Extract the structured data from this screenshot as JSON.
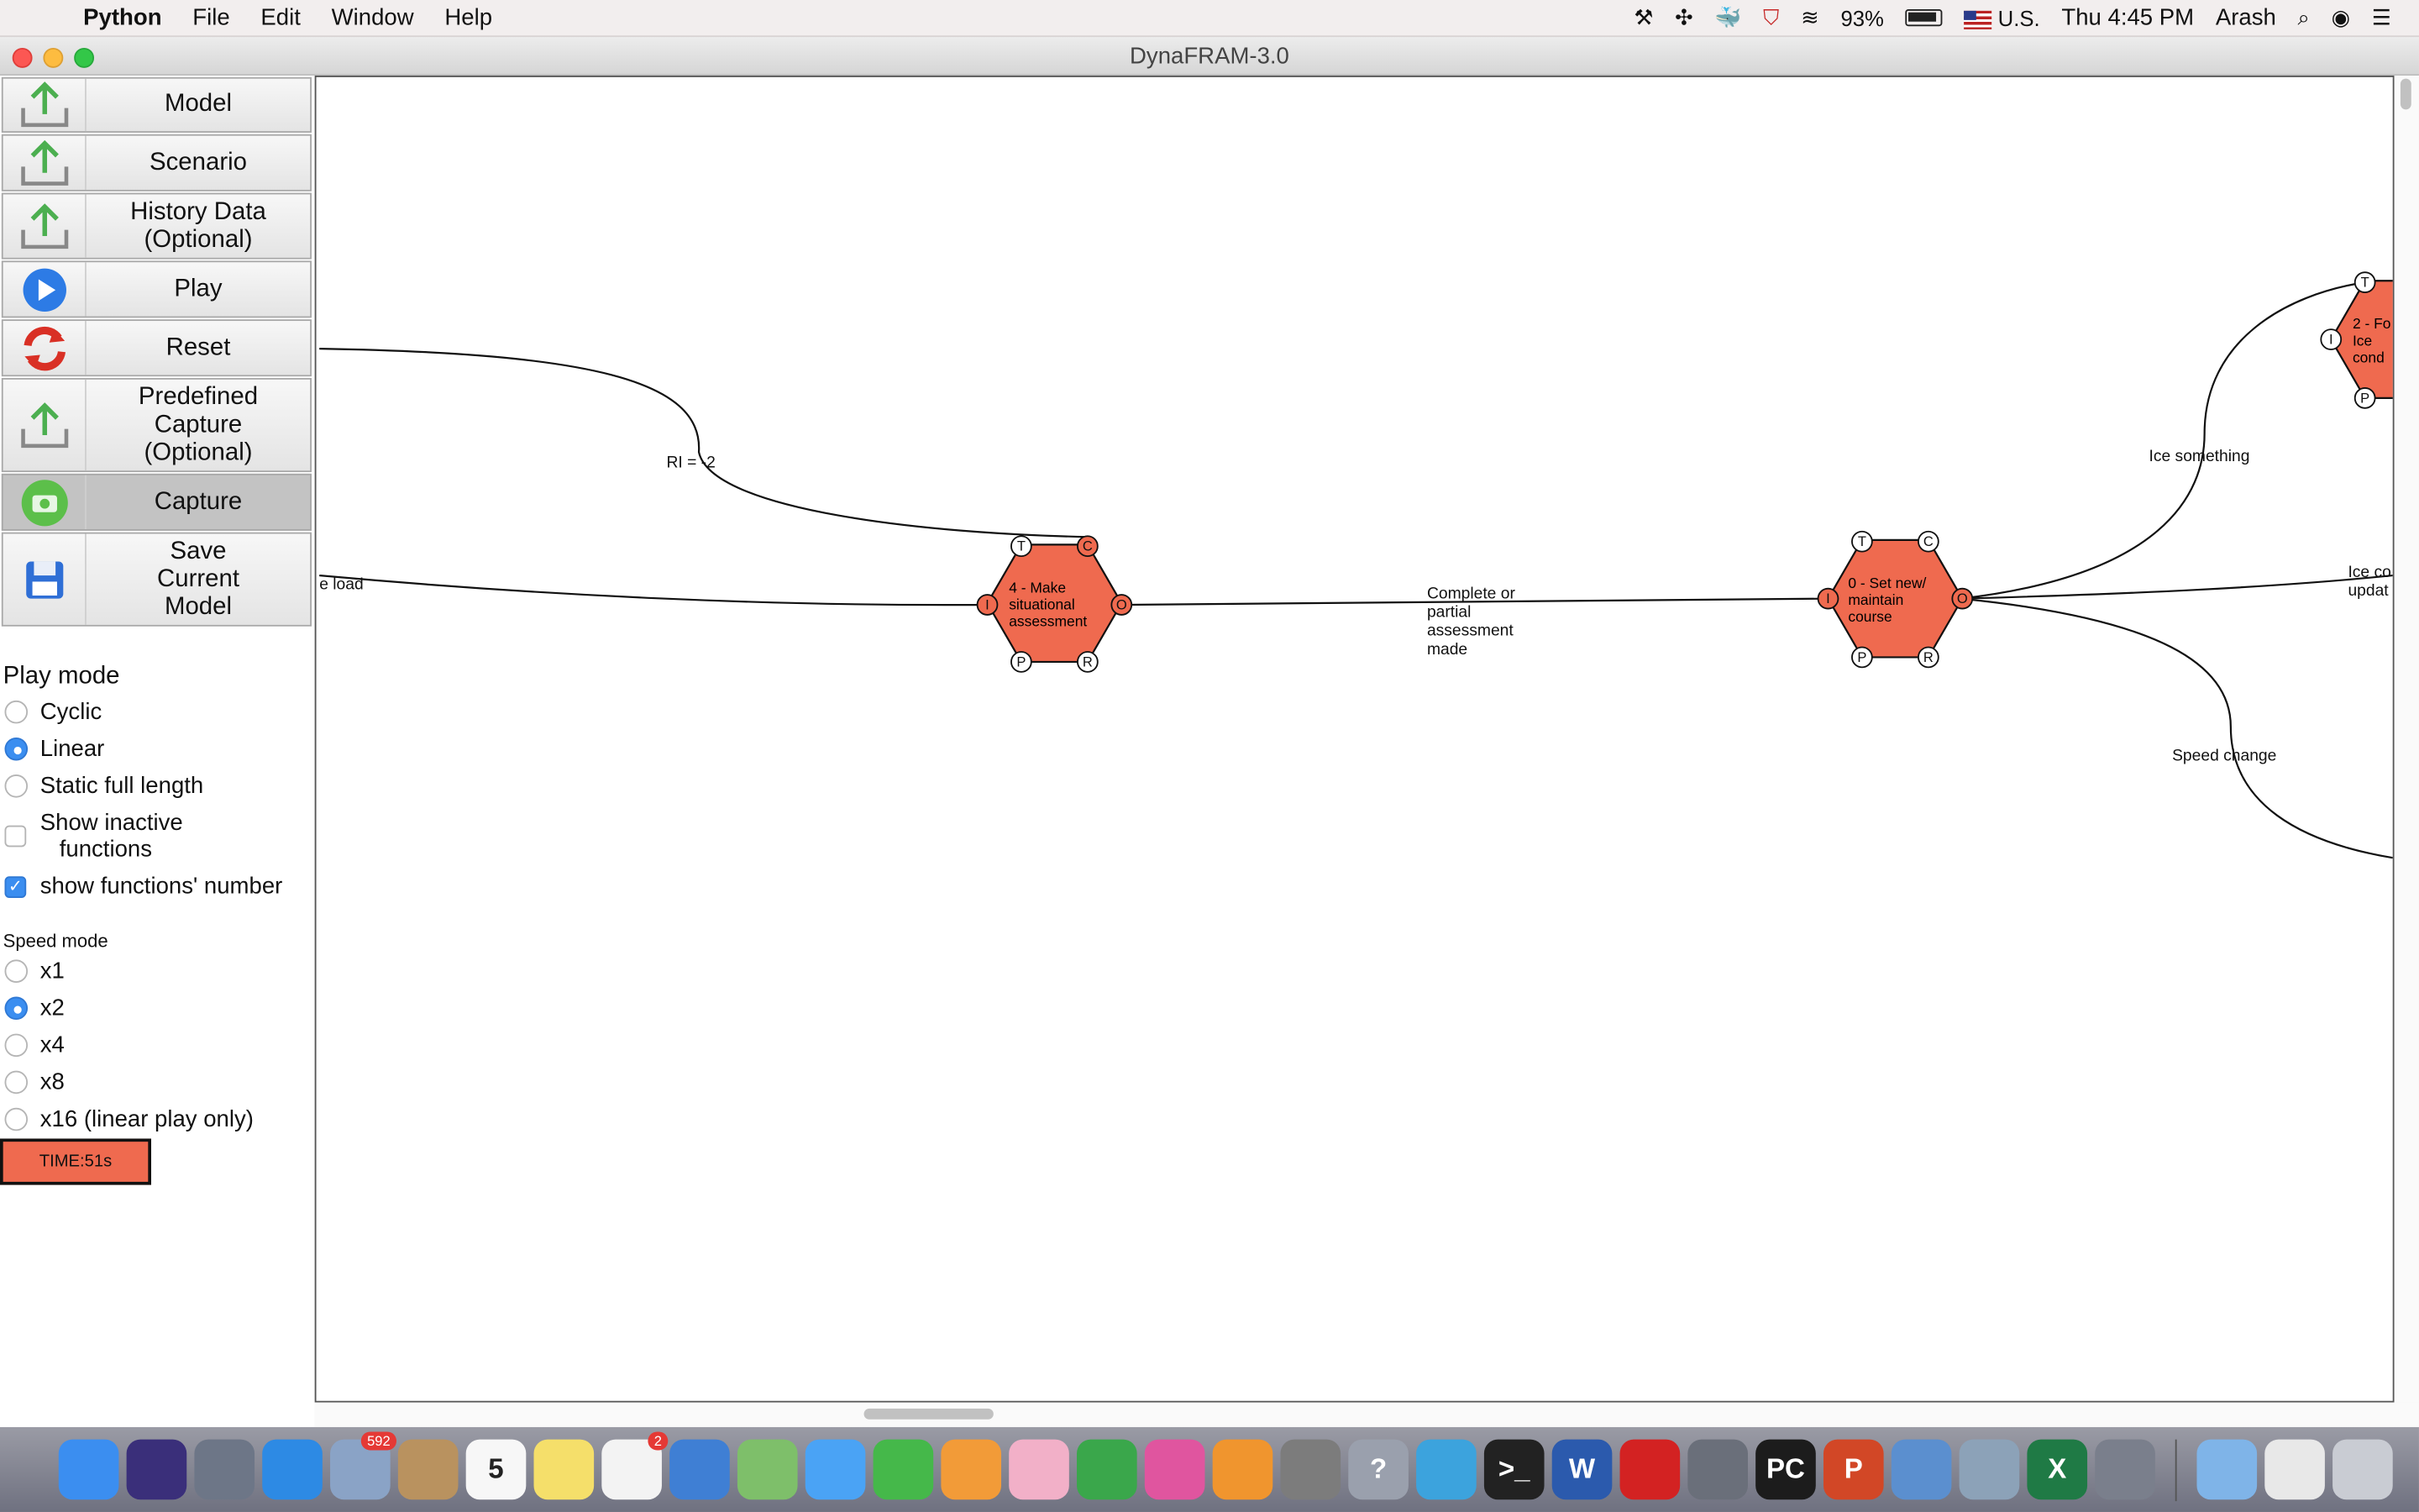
{
  "menubar": {
    "app_name": "Python",
    "menus": [
      "File",
      "Edit",
      "Window",
      "Help"
    ],
    "battery": "93%",
    "input_source": "U.S.",
    "clock": "Thu 4:45 PM",
    "user": "Arash"
  },
  "window": {
    "title": "DynaFRAM-3.0"
  },
  "sidebar": {
    "buttons": [
      {
        "label": "Model",
        "icon": "upload-icon"
      },
      {
        "label": "Scenario",
        "icon": "upload-icon"
      },
      {
        "label": "History Data\n(Optional)",
        "icon": "upload-icon"
      },
      {
        "label": "Play",
        "icon": "play-icon"
      },
      {
        "label": "Reset",
        "icon": "reset-icon"
      },
      {
        "label": "Predefined\nCapture\n(Optional)",
        "icon": "upload-icon"
      },
      {
        "label": "Capture",
        "icon": "camera-icon"
      },
      {
        "label": "Save\nCurrent\nModel",
        "icon": "floppy-disk-icon"
      }
    ],
    "play_mode": {
      "title": "Play mode",
      "options": [
        "Cyclic",
        "Linear",
        "Static full length"
      ],
      "selected": "Linear"
    },
    "show_inactive": {
      "label": "Show inactive\n   functions",
      "checked": false
    },
    "show_numbers": {
      "label": "show functions' number",
      "checked": true
    },
    "speed_mode": {
      "title": "Speed mode",
      "options": [
        "x1",
        "x2",
        "x4",
        "x8",
        "x16 (linear play only)"
      ],
      "selected": "x2"
    },
    "time": "TIME:51s"
  },
  "diagram": {
    "functions": [
      {
        "label": [
          "4 - Make",
          "situational",
          "assessment"
        ]
      },
      {
        "label": [
          "0 - Set new/",
          "maintain",
          "course"
        ]
      },
      {
        "label": [
          "2 - Fo",
          "Ice",
          "cond"
        ]
      }
    ],
    "aspects": {
      "T": "T",
      "C": "C",
      "I": "I",
      "O": "O",
      "P": "P",
      "R": "R"
    },
    "links": [
      {
        "label": "RI = -2"
      },
      {
        "label": "e load"
      },
      {
        "label": "Complete or\npartial\nassessment\nmade"
      },
      {
        "label": "Ice something"
      },
      {
        "label": "Ice co\nupdat"
      },
      {
        "label": "Speed change"
      }
    ],
    "colors": {
      "function_fill": "#ef6a4f",
      "stroke": "#111111"
    }
  },
  "dock": {
    "apps": [
      {
        "name": "finder-icon",
        "color": "#3b8ef0"
      },
      {
        "name": "siri-icon",
        "color": "#3a2f7a"
      },
      {
        "name": "launchpad-icon",
        "color": "#6d7687"
      },
      {
        "name": "safari-icon",
        "color": "#2d8ae4"
      },
      {
        "name": "mail-icon",
        "color": "#8aa3c6",
        "badge": "592"
      },
      {
        "name": "contacts-icon",
        "color": "#b9925f"
      },
      {
        "name": "calendar-icon",
        "color": "#f7f7f7",
        "text": "5"
      },
      {
        "name": "notes-icon",
        "color": "#f5df6a"
      },
      {
        "name": "reminders-icon",
        "color": "#f3f3f3",
        "badge": "2"
      },
      {
        "name": "keynote-icon",
        "color": "#3f7fd4"
      },
      {
        "name": "maps-icon",
        "color": "#7ebf6a"
      },
      {
        "name": "messages-icon",
        "color": "#4aa3f5"
      },
      {
        "name": "facetime-icon",
        "color": "#45b84a"
      },
      {
        "name": "pages-icon",
        "color": "#f29b38"
      },
      {
        "name": "photos-icon",
        "color": "#f2b0c8"
      },
      {
        "name": "numbers-icon",
        "color": "#3aa74b"
      },
      {
        "name": "itunes-icon",
        "color": "#e0559f"
      },
      {
        "name": "books-icon",
        "color": "#f0952e"
      },
      {
        "name": "system-preferences-icon",
        "color": "#7c7c7c"
      },
      {
        "name": "help-icon",
        "color": "#9aa0ad",
        "text": "?"
      },
      {
        "name": "telegram-icon",
        "color": "#3ca3dd"
      },
      {
        "name": "terminal-icon",
        "color": "#222222",
        "text": ">_"
      },
      {
        "name": "word-icon",
        "color": "#2b5aad",
        "text": "W"
      },
      {
        "name": "acrobat-icon",
        "color": "#d32222"
      },
      {
        "name": "utilities-icon",
        "color": "#6a6f7a"
      },
      {
        "name": "pycharm-icon",
        "color": "#1c1c1c",
        "text": "PC"
      },
      {
        "name": "powerpoint-icon",
        "color": "#d24726",
        "text": "P"
      },
      {
        "name": "preview-icon",
        "color": "#5b8fcf"
      },
      {
        "name": "image-capture-icon",
        "color": "#8ca2b8"
      },
      {
        "name": "excel-icon",
        "color": "#1f7a45",
        "text": "X"
      },
      {
        "name": "rocket-icon",
        "color": "#7a7f8c"
      },
      {
        "name": "downloads-folder-icon",
        "color": "#7fb4e8"
      },
      {
        "name": "documents-icon",
        "color": "#e8e8e8"
      },
      {
        "name": "trash-icon",
        "color": "#c9ccd3"
      }
    ]
  }
}
